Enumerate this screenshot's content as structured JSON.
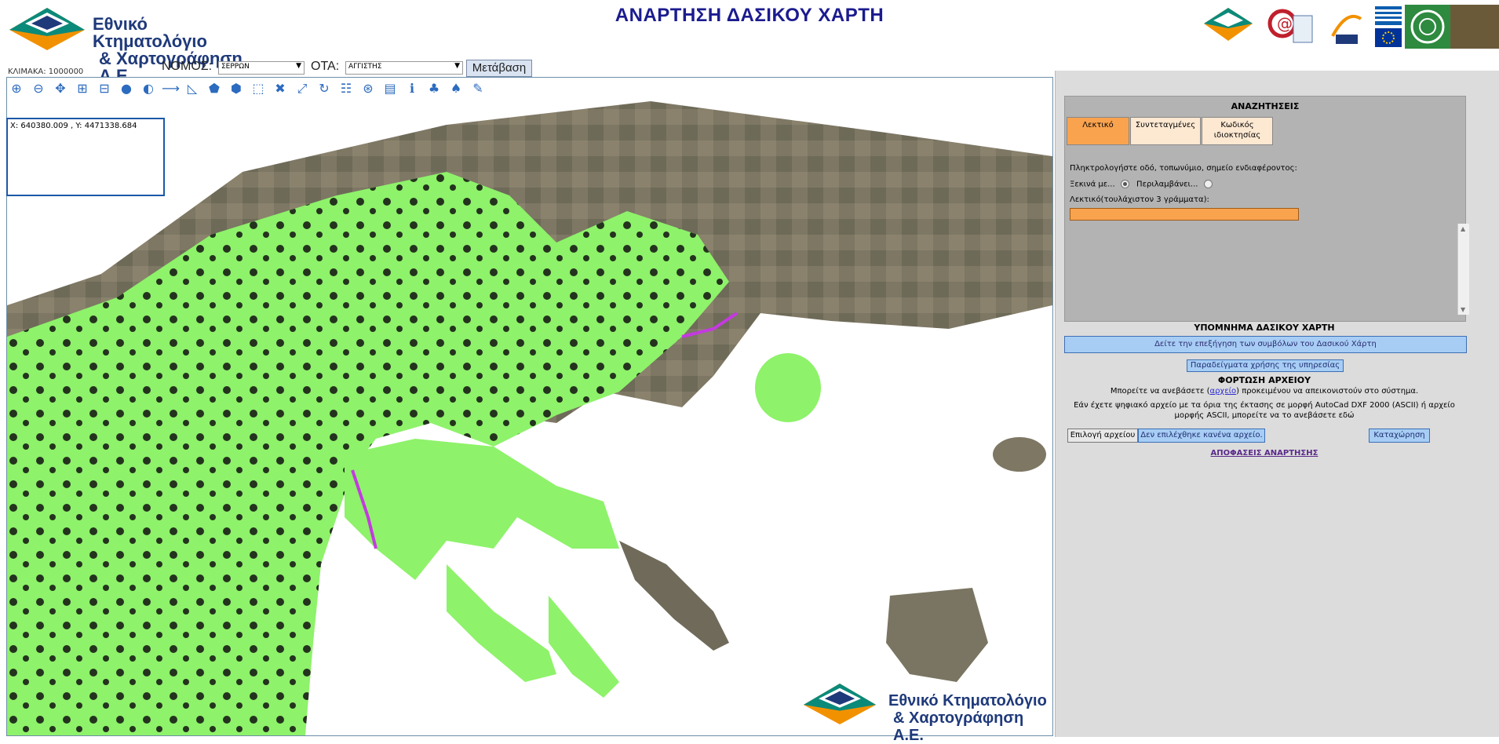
{
  "header": {
    "title": "ΑΝΑΡΤΗΣΗ ΔΑΣΙΚΟΥ ΧΑΡΤΗ",
    "logo_line1": "Εθνικό Κτηματολόγιο",
    "logo_line2": "& Χαρτογράφηση Α.Ε."
  },
  "controls": {
    "scale_label": "ΚΛΙΜΑΚΑ: 1000000",
    "nomos_label": "ΝΟΜΟΣ:",
    "nomos_value": "ΣΕΡΡΩΝ",
    "ota_label": "ΟΤΑ:",
    "ota_value": "ΑΓΓΙΣΤΗΣ",
    "go_label": "Μετάβαση"
  },
  "map": {
    "coordinates": "X: 640380.009 , Y: 4471338.684",
    "watermark_line1": "Εθνικό Κτηματολόγιο",
    "watermark_line2": "& Χαρτογράφηση Α.Ε."
  },
  "toolbar": [
    {
      "name": "zoom-in-icon",
      "glyph": "⊕"
    },
    {
      "name": "zoom-out-icon",
      "glyph": "⊖"
    },
    {
      "name": "pan-icon",
      "glyph": "✥"
    },
    {
      "name": "zoom-box-icon",
      "glyph": "⊞"
    },
    {
      "name": "zoom-extent-icon",
      "glyph": "⊟"
    },
    {
      "name": "user-locate-icon",
      "glyph": "●"
    },
    {
      "name": "globe-icon",
      "glyph": "◐"
    },
    {
      "name": "measure-distance-icon",
      "glyph": "⟶"
    },
    {
      "name": "measure-angle-icon",
      "glyph": "◺"
    },
    {
      "name": "polygon-icon",
      "glyph": "⬟"
    },
    {
      "name": "polygon-xy-icon",
      "glyph": "⬢"
    },
    {
      "name": "select-icon",
      "glyph": "⬚"
    },
    {
      "name": "clear-icon",
      "glyph": "✖"
    },
    {
      "name": "snap-icon",
      "glyph": "⤢"
    },
    {
      "name": "refresh-icon",
      "glyph": "↻"
    },
    {
      "name": "xy-input-icon",
      "glyph": "☷"
    },
    {
      "name": "xy-goto-icon",
      "glyph": "⊛"
    },
    {
      "name": "layers-icon",
      "glyph": "▤"
    },
    {
      "name": "info-icon",
      "glyph": "ℹ"
    },
    {
      "name": "forest-tree-icon",
      "glyph": "♣"
    },
    {
      "name": "tree-icon",
      "glyph": "♠"
    },
    {
      "name": "broom-icon",
      "glyph": "✎"
    }
  ],
  "search": {
    "title": "ΑΝΑΖΗΤΗΣΕΙΣ",
    "tab_text": "Λεκτικό",
    "tab_coords": "Συντεταγμένες",
    "tab_parcel_line1": "Κωδικός",
    "tab_parcel_line2": "ιδιοκτησίας",
    "hint": "Πληκτρολογήστε οδό, τοπωνύμιο, σημείο ενδιαφέροντος:",
    "starts_with": "Ξεκινά με...",
    "contains": "Περιλαμβάνει...",
    "field_label": "Λεκτικό(τουλάχιστον 3 γράμματα):",
    "input_value": ""
  },
  "legend": {
    "title": "ΥΠΟΜΝΗΜΑ ΔΑΣΙΚΟΥ ΧΑΡΤΗ",
    "button": "Δείτε την επεξήγηση των συμβόλων του Δασικού Χάρτη"
  },
  "examples_button": "Παραδείγματα χρήσης της υπηρεσίας",
  "upload": {
    "title": "ΦΟΡΤΩΣΗ ΑΡΧΕΙΟΥ",
    "text1_before": "Μπορείτε να ανεβάσετε (",
    "text1_link": "αρχείο",
    "text1_after": ") προκειμένου να απεικονιστούν στο σύστημα.",
    "text2_line1": "Εάν έχετε ψηφιακό αρχείο με τα όρια της έκτασης σε μορφή AutoCad DXF 2000 (ASCII) ή αρχείο",
    "text2_line2": "μορφής ASCII, μπορείτε να το ανεβάσετε εδώ",
    "choose": "Επιλογή αρχείου",
    "status": "Δεν επιλέχθηκε κανένα αρχείο.",
    "submit": "Καταχώρηση"
  },
  "decisions_link": "ΑΠΟΦΑΣΕΙΣ ΑΝΑΡΤΗΣΗΣ"
}
